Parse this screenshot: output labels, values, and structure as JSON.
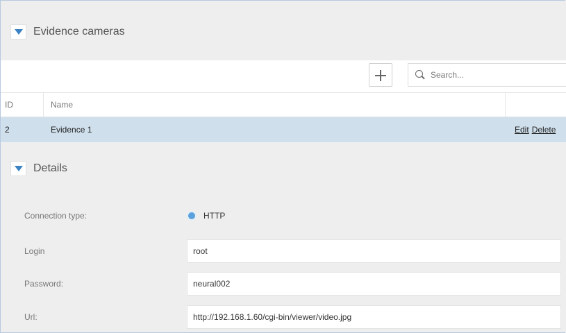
{
  "evidence_section": {
    "title": "Evidence cameras"
  },
  "toolbar": {
    "search_placeholder": "Search..."
  },
  "table": {
    "columns": {
      "id": "ID",
      "name": "Name"
    },
    "rows": [
      {
        "id": "2",
        "name": "Evidence 1",
        "edit": "Edit",
        "delete": "Delete"
      }
    ]
  },
  "details_section": {
    "title": "Details"
  },
  "details": {
    "connection_type": {
      "label": "Connection type:",
      "value": "HTTP"
    },
    "login": {
      "label": "Login",
      "value": "root"
    },
    "password": {
      "label": "Password:",
      "value": "neural002"
    },
    "url": {
      "label": "Url:",
      "value": "http://192.168.1.60/cgi-bin/viewer/video.jpg"
    }
  },
  "colors": {
    "accent": "#3b82c4",
    "selected_row": "#cfdfec",
    "radio": "#5aa0dc",
    "background": "#eeeeee"
  }
}
